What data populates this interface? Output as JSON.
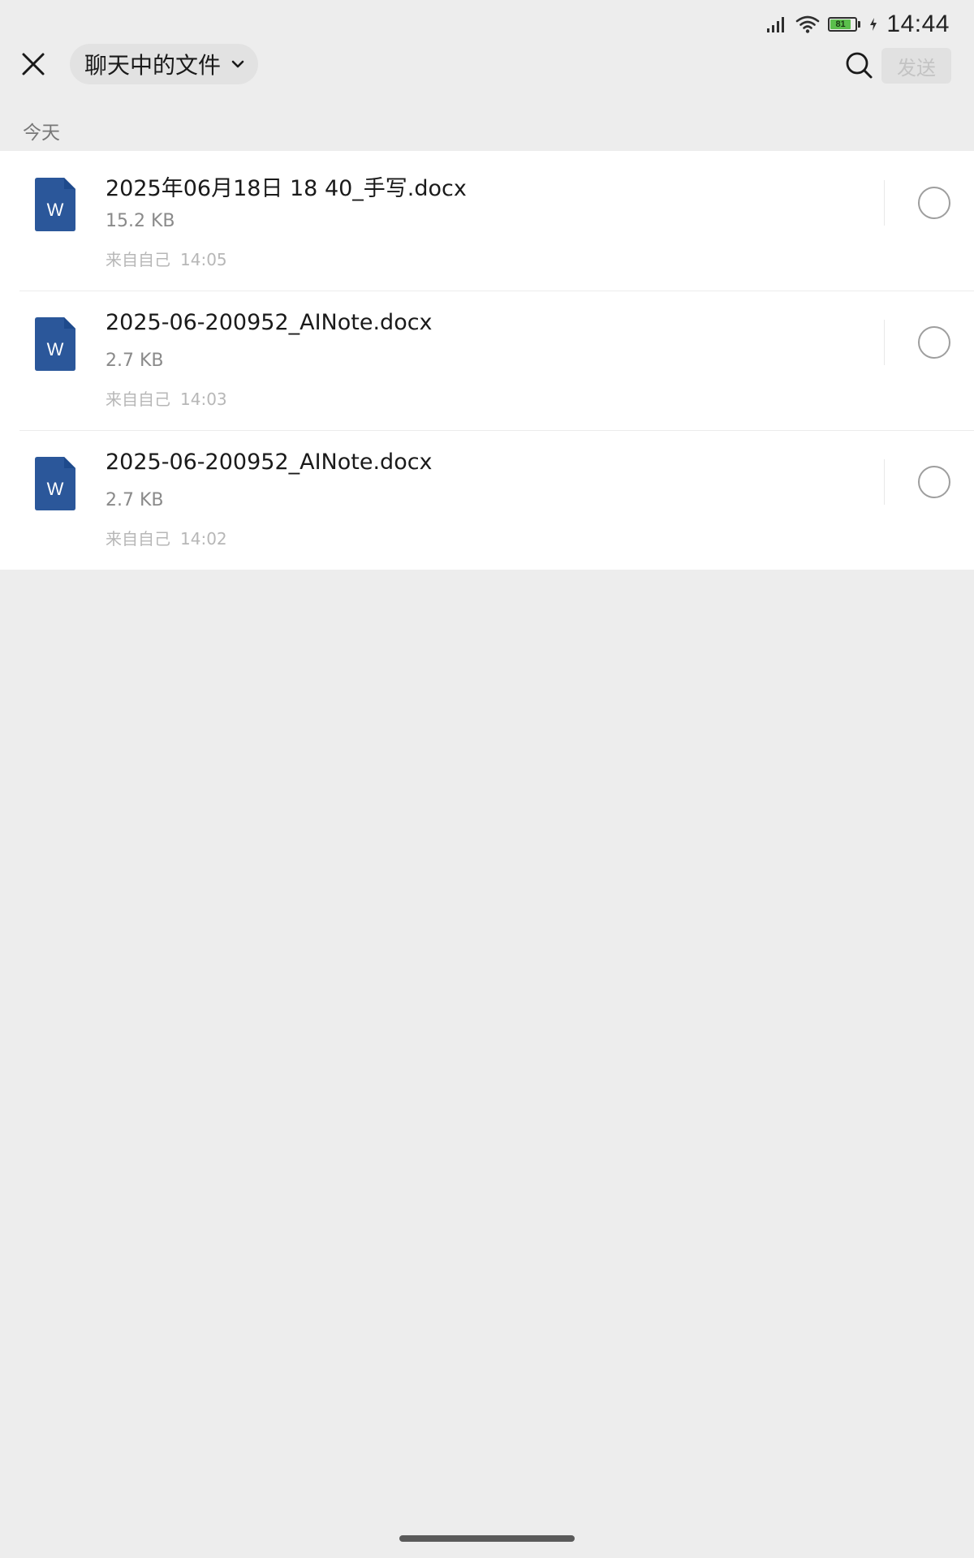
{
  "status_bar": {
    "time": "14:44",
    "battery_level": "81",
    "icons": [
      "signal-icon",
      "wifi-icon",
      "battery-icon",
      "charging-icon"
    ]
  },
  "header": {
    "title": "聊天中的文件",
    "send_label": "发送",
    "icons": [
      "close-icon",
      "chevron-down-icon",
      "search-icon"
    ]
  },
  "section": {
    "label": "今天"
  },
  "files": [
    {
      "name": "2025年06月18日 18 40_手写.docx",
      "size": "15.2 KB",
      "source": "来自自己",
      "time": "14:05",
      "icon": "word-doc-icon",
      "selected": false
    },
    {
      "name": "2025-06-200952_AINote.docx",
      "size": "2.7 KB",
      "source": "来自自己",
      "time": "14:03",
      "icon": "word-doc-icon",
      "selected": false
    },
    {
      "name": "2025-06-200952_AINote.docx",
      "size": "2.7 KB",
      "source": "来自自己",
      "time": "14:02",
      "icon": "word-doc-icon",
      "selected": false
    }
  ],
  "colors": {
    "background": "#ededed",
    "word_blue": "#2b579a",
    "word_blue_dark": "#1e4a8c",
    "send_disabled_bg": "#e1e1e1",
    "send_disabled_text": "#c3c3c3",
    "battery_green": "#5bbf4c"
  }
}
